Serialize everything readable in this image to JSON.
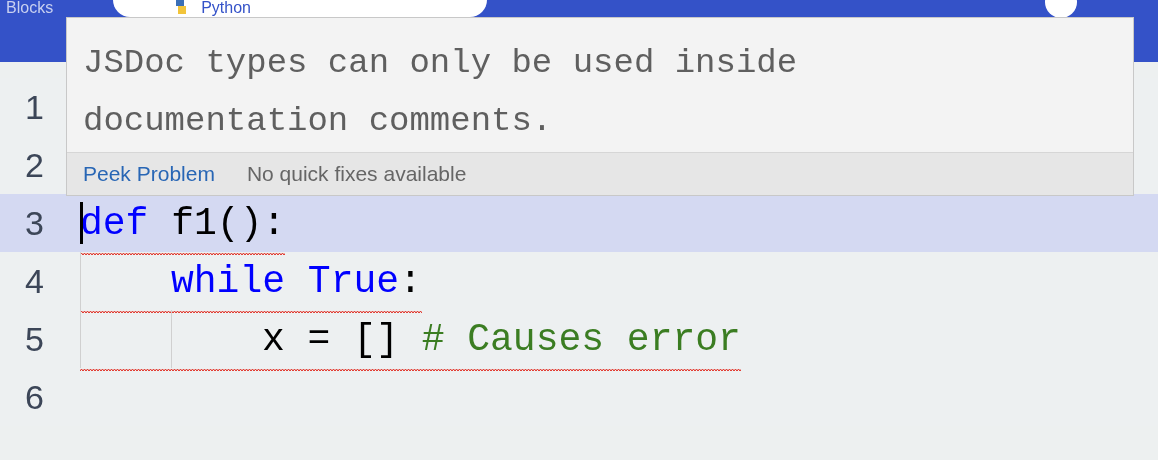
{
  "top_bar": {
    "tabs": [
      {
        "label": "Blocks",
        "selected": false
      },
      {
        "label": "Python",
        "selected": true
      }
    ]
  },
  "hover": {
    "message": "JSDoc types can only be used inside documentation comments.",
    "actions": [
      {
        "label": "Peek Problem",
        "kind": "link"
      },
      {
        "label": "No quick fixes available",
        "kind": "status"
      }
    ]
  },
  "editor": {
    "lines": [
      {
        "number": "1",
        "current": false
      },
      {
        "number": "2",
        "current": false
      },
      {
        "number": "3",
        "current": true,
        "error": true,
        "tokens": [
          {
            "text": "def",
            "kind": "keyword"
          },
          {
            "text": " f1():",
            "kind": "plain"
          }
        ]
      },
      {
        "number": "4",
        "current": false,
        "error": true,
        "tokens": [
          {
            "kind": "indent"
          },
          {
            "text": "while True",
            "kind": "keyword"
          },
          {
            "text": ":",
            "kind": "plain"
          }
        ]
      },
      {
        "number": "5",
        "current": false,
        "error": true,
        "tokens": [
          {
            "kind": "indent"
          },
          {
            "kind": "indent"
          },
          {
            "text": "x = [] ",
            "kind": "plain"
          },
          {
            "text": "# Causes error",
            "kind": "comment"
          }
        ]
      },
      {
        "number": "6",
        "current": false
      }
    ]
  }
}
